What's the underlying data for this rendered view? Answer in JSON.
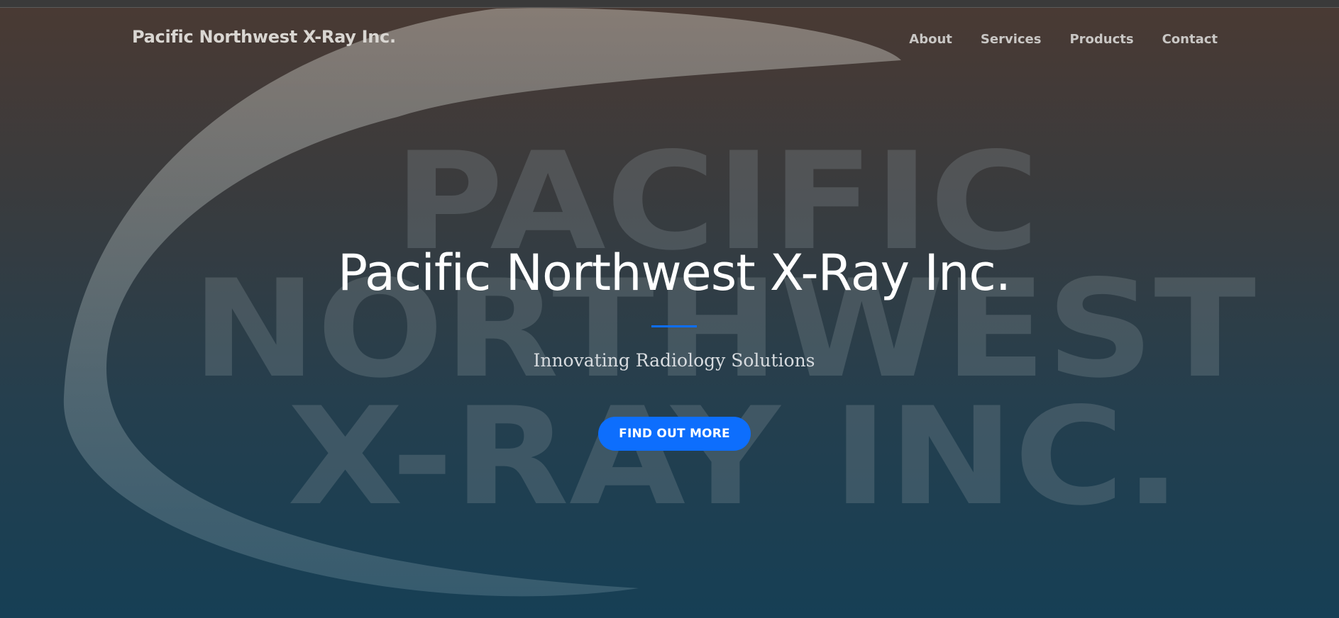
{
  "navbar": {
    "brand": "Pacific Northwest X-Ray Inc.",
    "links": [
      "About",
      "Services",
      "Products",
      "Contact"
    ]
  },
  "hero": {
    "title": "Pacific Northwest X-Ray Inc.",
    "subtitle": "Innovating Radiology Solutions",
    "cta_label": "FIND OUT MORE"
  },
  "background_logo": {
    "line1": "PACIFIC",
    "line2": "NORTHWEST",
    "line3": "X-RAY INC."
  },
  "colors": {
    "accent": "#0d6efd",
    "header_bg": "#4a3a33",
    "footer_bg": "#163f55",
    "title_text": "#ffffff",
    "subtitle_text": "#d7dbdf"
  }
}
